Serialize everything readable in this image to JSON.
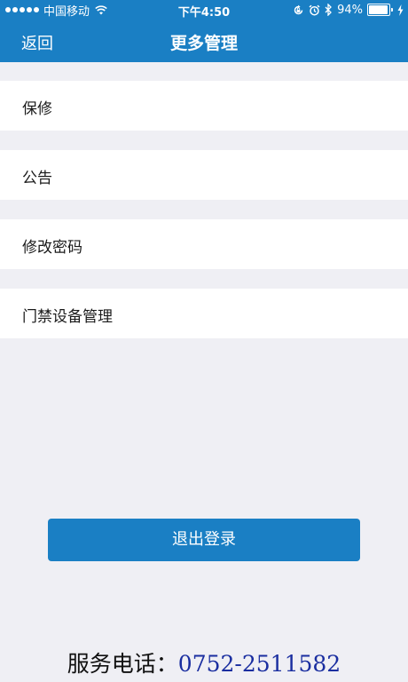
{
  "status_bar": {
    "carrier": "中国移动",
    "time": "下午4:50",
    "battery_percent": "94%",
    "battery_level": 0.94,
    "icons": [
      "signal-dots-icon",
      "wifi-icon",
      "rotation-lock-icon",
      "alarm-icon",
      "bluetooth-icon",
      "battery-icon",
      "charging-icon"
    ]
  },
  "nav": {
    "back_label": "返回",
    "title": "更多管理"
  },
  "menu": {
    "items": [
      {
        "label": "保修"
      },
      {
        "label": "公告"
      },
      {
        "label": "修改密码"
      },
      {
        "label": "门禁设备管理"
      }
    ]
  },
  "logout": {
    "label": "退出登录"
  },
  "footer": {
    "service_label": "服务电话：",
    "service_number": "0752-2511582"
  },
  "colors": {
    "primary": "#1a7fc4",
    "background": "#efeff4",
    "item_background": "#ffffff",
    "phone_number": "#1a2ea0"
  }
}
